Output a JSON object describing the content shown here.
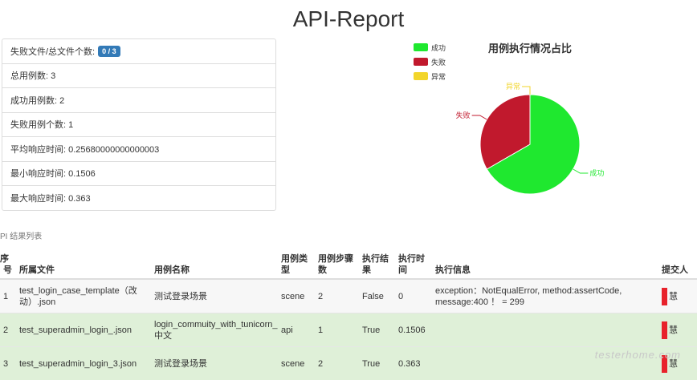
{
  "title": "API-Report",
  "summary": {
    "fail_files_label": "失败文件/总文件个数:",
    "fail_files_badge": "0 / 3",
    "total_cases": "总用例数: 3",
    "success_cases": "成功用例数: 2",
    "failed_cases": "失败用例个数: 1",
    "avg_time": "平均响应时间: 0.25680000000000003",
    "min_time": "最小响应时间: 0.1506",
    "max_time": "最大响应时间: 0.363"
  },
  "chart_data": {
    "type": "pie",
    "title": "用例执行情况占比",
    "categories": [
      "成功",
      "失败",
      "异常"
    ],
    "values": [
      2,
      1,
      0
    ],
    "colors": [
      "#1fe82f",
      "#c1192d",
      "#f2d52b"
    ],
    "legend_position": "top-left"
  },
  "section_label": "PI 结果列表",
  "table": {
    "headers": [
      "序号",
      "所属文件",
      "用例名称",
      "用例类型",
      "用例步骤数",
      "执行结果",
      "执行时间",
      "执行信息",
      "提交人"
    ],
    "rows": [
      {
        "idx": "1",
        "file": "test_login_case_template（改动）.json",
        "name": "测试登录场景",
        "type": "scene",
        "steps": "2",
        "result": "False",
        "time": "0",
        "info": "exception：NotEqualError, method:assertCode, message:400 ！ = 299",
        "submitter": "慧",
        "status": "fail"
      },
      {
        "idx": "2",
        "file": "test_superadmin_login_.json",
        "name": "login_commuity_with_tunicorn_中文",
        "type": "api",
        "steps": "1",
        "result": "True",
        "time": "0.1506",
        "info": "",
        "submitter": "慧",
        "status": "pass"
      },
      {
        "idx": "3",
        "file": "test_superadmin_login_3.json",
        "name": "测试登录场景",
        "type": "scene",
        "steps": "2",
        "result": "True",
        "time": "0.363",
        "info": "",
        "submitter": "慧",
        "status": "pass"
      }
    ]
  },
  "watermark": "testerhome.com"
}
